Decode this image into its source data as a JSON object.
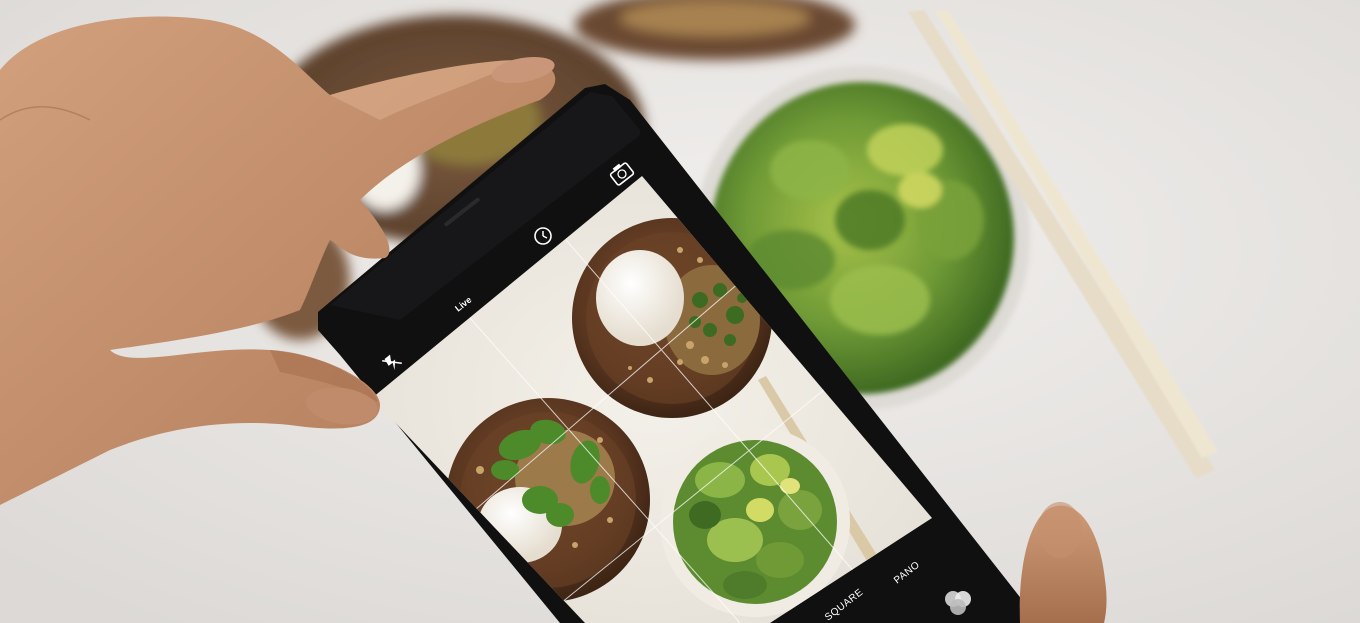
{
  "camera_ui": {
    "live_label": "Live",
    "modes": [
      "SQUARE",
      "PANO"
    ]
  },
  "icons": {
    "flash": "flash-off-icon",
    "timer": "timer-icon",
    "switch_camera": "switch-camera-icon",
    "filters": "filters-icon"
  },
  "colors": {
    "table": "#e9e7e5",
    "phone_body": "#141414",
    "wood_plate": "#5a3822",
    "lettuce": "#6d9a3c",
    "skin": "#c4916e"
  }
}
